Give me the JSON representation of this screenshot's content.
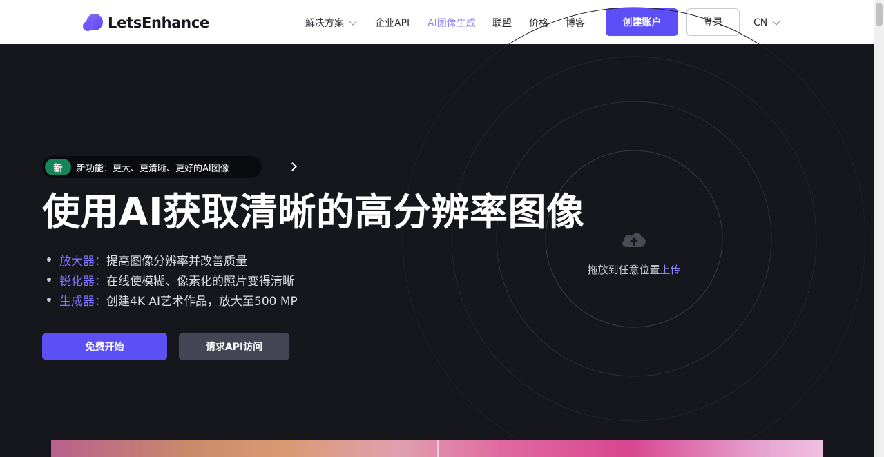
{
  "brand": {
    "name": "LetsEnhance"
  },
  "nav": {
    "items": [
      {
        "label": "解决方案",
        "has_dropdown": true
      },
      {
        "label": "企业API"
      },
      {
        "label": "AI图像生成",
        "active": true
      },
      {
        "label": "联盟"
      },
      {
        "label": "价格"
      },
      {
        "label": "博客"
      }
    ],
    "create_account": "创建账户",
    "login": "登录",
    "language": "CN"
  },
  "hero": {
    "badge_new": "新",
    "badge_text": "新功能：更大、更清晰、更好的AI图像",
    "headline": "使用AI获取清晰的高分辨率图像",
    "features": [
      {
        "key": "放大器：",
        "text": "提高图像分辨率并改善质量"
      },
      {
        "key": "锐化器：",
        "text": "在线使模糊、像素化的照片变得清晰"
      },
      {
        "key": "生成器：",
        "text": "创建4K AI艺术作品，放大至500 MP"
      }
    ],
    "primary_button": "免费开始",
    "secondary_button": "请求API访问"
  },
  "upload": {
    "text": "拖放到任意位置",
    "link": "上传",
    "icon": "cloud-upload-icon"
  },
  "colors": {
    "accent": "#5b4ff5",
    "accent_light": "#7f74ff",
    "background": "#16171d",
    "badge_green": "#17845a"
  }
}
